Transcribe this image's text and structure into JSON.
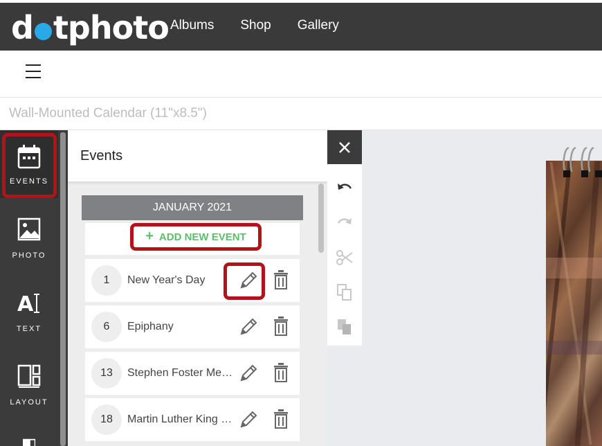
{
  "header": {
    "logo_left": "d",
    "logo_right": "tphoto",
    "nav": [
      "Albums",
      "Shop",
      "Gallery"
    ]
  },
  "document": {
    "title": "Wall-Mounted Calendar (11\"x8.5\")"
  },
  "toolbar": {
    "tools": [
      {
        "label": "EVENTS",
        "icon": "calendar-icon"
      },
      {
        "label": "PHOTO",
        "icon": "photo-icon"
      },
      {
        "label": "TEXT",
        "icon": "text-icon"
      },
      {
        "label": "LAYOUT",
        "icon": "layout-icon"
      }
    ]
  },
  "events_panel": {
    "title": "Events",
    "month": "JANUARY 2021",
    "add_label": "ADD NEW EVENT",
    "events": [
      {
        "day": "1",
        "name": "New Year's Day"
      },
      {
        "day": "6",
        "name": "Epiphany"
      },
      {
        "day": "13",
        "name": "Stephen Foster Memorial Day"
      },
      {
        "day": "18",
        "name": "Martin Luther King Jr. Day"
      }
    ]
  },
  "colors": {
    "accent_green": "#5bbf6c",
    "highlight_red": "#b4121b",
    "logo_dot": "#29a9e8",
    "dark_bar": "#3a3a3a"
  }
}
